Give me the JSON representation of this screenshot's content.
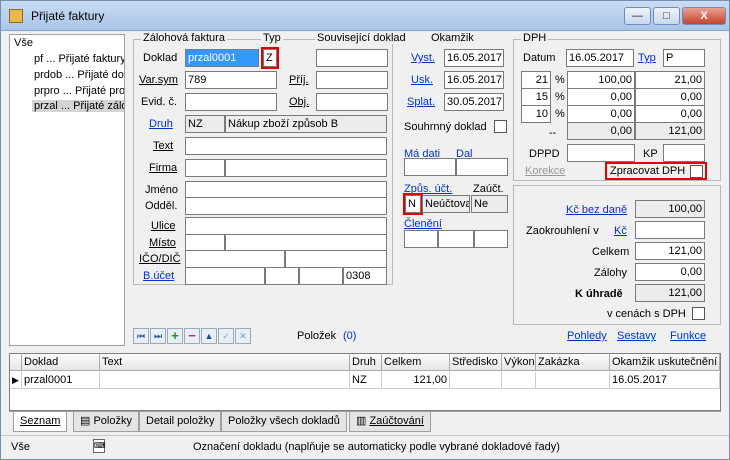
{
  "window": {
    "title": "Přijaté faktury",
    "minimize": "—",
    "maximize": "□",
    "close": "X"
  },
  "tree": {
    "root": "Vše",
    "items": [
      "pf ... Přijaté faktury",
      "prdob ... Přijaté dol",
      "prpro ... Přijaté prol",
      "przal ... Přijaté zálo"
    ]
  },
  "doc": {
    "sec_zal": "Zálohová faktura",
    "sec_typ": "Typ",
    "sec_souv": "Související doklad",
    "sec_okamzik": "Okamžik",
    "lbl_doklad": "Doklad",
    "doklad": "przal0001",
    "typ": "Z",
    "lbl_varsym": "Var.sym",
    "varsym": "789",
    "lbl_prij": "Příj.",
    "lbl_evid": "Evid. č.",
    "lbl_obj": "Obj.",
    "lbl_vyst": "Vyst.",
    "vyst": "16.05.2017",
    "lbl_usk": "Usk.",
    "usk": "16.05.2017",
    "lbl_splat": "Splat.",
    "splat": "30.05.2017",
    "lbl_druh": "Druh",
    "druh_code": "NZ",
    "druh_name": "Nákup zboží způsob B",
    "lbl_text": "Text",
    "lbl_firma": "Firma",
    "lbl_jmeno": "Jméno",
    "lbl_oddel": "Odděl.",
    "lbl_ulice": "Ulice",
    "lbl_misto": "Místo",
    "lbl_ico": "IČO/DIČ",
    "lbl_bucet": "B.účet",
    "bucet_code": "0308",
    "lbl_souhrn": "Souhrnný doklad",
    "lbl_madati": "Má dati",
    "lbl_dal": "Dal",
    "lbl_zpus": "Způs. účt.",
    "lbl_zauct": "Zaúčt.",
    "zpus": "N",
    "zpus_name": "Neúčtova",
    "zauct": "Ne",
    "lbl_cleneni": "Členění"
  },
  "dph": {
    "sec": "DPH",
    "lbl_datum": "Datum",
    "datum": "16.05.2017",
    "lbl_typ": "Typ",
    "typ": "P",
    "rows": [
      {
        "rate": "21",
        "pct": "%",
        "base": "100,00",
        "tax": "21,00"
      },
      {
        "rate": "15",
        "pct": "%",
        "base": "0,00",
        "tax": "0,00"
      },
      {
        "rate": "10",
        "pct": "%",
        "base": "0,00",
        "tax": "0,00"
      }
    ],
    "dash": "--",
    "sum_base": "0,00",
    "sum_tax": "121,00",
    "lbl_dppd": "DPPD",
    "lbl_kp": "KP",
    "lbl_korekce": "Korekce",
    "lbl_zpracovat": "Zpracovat DPH"
  },
  "totals": {
    "lbl_bezdane": "Kč bez daně",
    "bezdane": "100,00",
    "lbl_zaokr": "Zaokrouhlení v",
    "lbl_kc": "Kč",
    "lbl_celkem": "Celkem",
    "celkem": "121,00",
    "lbl_zalohy": "Zálohy",
    "zalohy": "0,00",
    "lbl_kuhrade": "K úhradě",
    "kuhrade": "121,00",
    "lbl_vcenach": "v cenách s DPH"
  },
  "toolbar": {
    "first": "⏮",
    "last": "⏭",
    "add": "+",
    "del": "−",
    "up": "▲",
    "ok": "✓",
    "cancel": "✕",
    "lbl_polozek": "Položek",
    "polozek": "(0)",
    "pohledy": "Pohledy",
    "sestavy": "Sestavy",
    "funkce": "Funkce"
  },
  "grid": {
    "columns": [
      "Doklad",
      "Text",
      "Druh",
      "Celkem",
      "Středisko",
      "Výkon",
      "Zakázka",
      "Okamžik uskutečnění"
    ],
    "row": {
      "doklad": "przal0001",
      "text": "",
      "druh": "NZ",
      "celkem": "121,00",
      "stredisko": "",
      "vykon": "",
      "zakazka": "",
      "okamzik": "16.05.2017"
    }
  },
  "tabs": [
    "Seznam",
    "Položky",
    "Detail položky",
    "Položky všech dokladů",
    "Zaúčtování"
  ],
  "status": {
    "left": "Vše",
    "text": "Označení dokladu (naplňuje se automaticky podle vybrané dokladové řady)"
  }
}
